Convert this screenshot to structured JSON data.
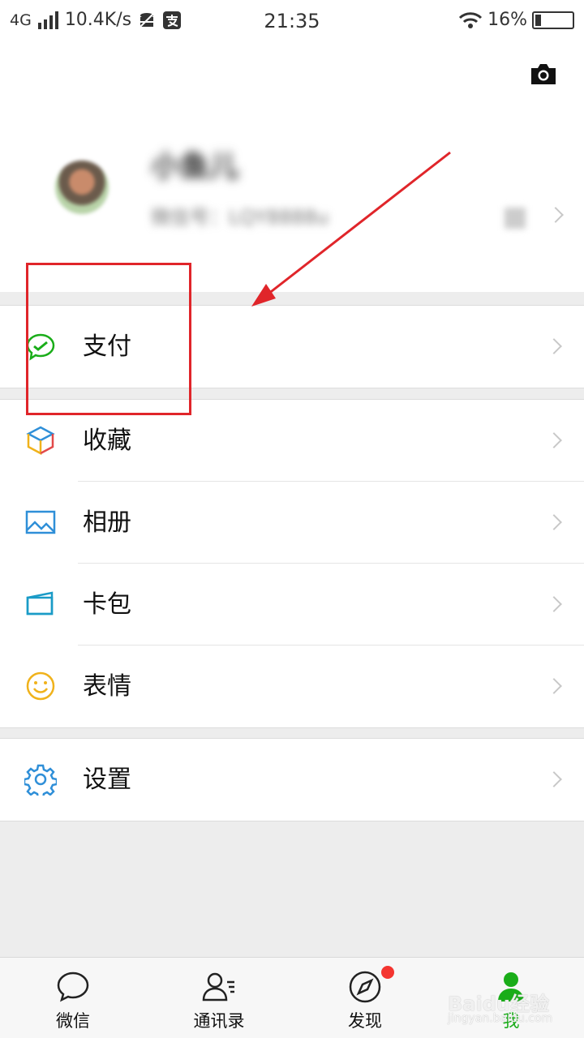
{
  "status_bar": {
    "network": "4G",
    "speed": "10.4K/s",
    "time": "21:35",
    "battery": "16%",
    "battery_level": 0.16
  },
  "profile": {
    "nickname": "小鱼儿",
    "wechat_id": "微信号：LQY8888u"
  },
  "menu": {
    "pay": "支付",
    "favorites": "收藏",
    "album": "相册",
    "cards": "卡包",
    "stickers": "表情",
    "settings": "设置"
  },
  "tabs": [
    {
      "label": "微信",
      "icon": "chat-bubble-icon"
    },
    {
      "label": "通讯录",
      "icon": "contacts-icon"
    },
    {
      "label": "发现",
      "icon": "compass-icon"
    },
    {
      "label": "我",
      "icon": "me-person-icon"
    }
  ],
  "watermark": {
    "text": "Baidu经验",
    "sub": "jingyan.baidu.com"
  },
  "colors": {
    "accent_green": "#1aad19",
    "annotation_red": "#e0252a",
    "badge_red": "#f43530",
    "background": "#ededed"
  }
}
